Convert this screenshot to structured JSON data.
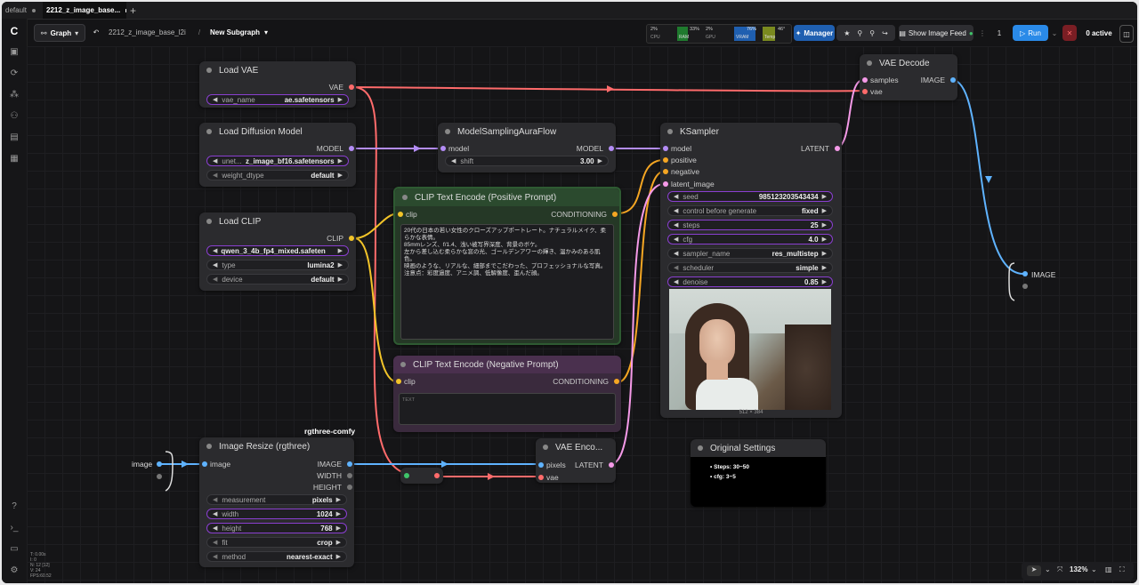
{
  "tabs": [
    {
      "label": "default"
    },
    {
      "label": "2212_z_image_base..."
    }
  ],
  "new_tab_icon": "plus-icon",
  "toolbar": {
    "graph_label": "Graph",
    "breadcrumb": "2212_z_image_base_l2i",
    "separator": "/",
    "subgraph": "New Subgraph",
    "monitor": {
      "cpu_pct": "2%",
      "cpu_label": "CPU",
      "ram_pct": "33%",
      "ram_label": "RAM",
      "gpu_pct": "2%",
      "gpu_label": "GPU",
      "vram_pct": "76%",
      "vram_label": "VRAM",
      "temp": "46°",
      "temp_label": "Temp"
    },
    "manager": "Manager",
    "show_feed": "Show Image Feed",
    "queue_count": "1",
    "run": "Run",
    "active": "0 active"
  },
  "nodes": {
    "load_vae": {
      "title": "Load VAE",
      "out": "VAE",
      "w_label": "vae_name",
      "w_value": "ae.safetensors"
    },
    "load_diff": {
      "title": "Load Diffusion Model",
      "out": "MODEL",
      "w1_label": "unet...",
      "w1_value": "z_image_bf16.safetensors",
      "w2_label": "weight_dtype",
      "w2_value": "default"
    },
    "load_clip": {
      "title": "Load CLIP",
      "out": "CLIP",
      "w1_value": "qwen_3_4b_fp4_mixed.safeten",
      "w2_label": "type",
      "w2_value": "lumina2",
      "w3_label": "device",
      "w3_value": "default"
    },
    "aura": {
      "title": "ModelSamplingAuraFlow",
      "in": "model",
      "out": "MODEL",
      "w_label": "shift",
      "w_value": "3.00"
    },
    "pos": {
      "title": "CLIP Text Encode (Positive Prompt)",
      "in": "clip",
      "out": "CONDITIONING",
      "text": "20代の日本の若い女性のクローズアップポートレート。ナチュラルメイク、柔らかな表情。\n85mmレンズ、f/1.4、浅い被写界深度、背景のボケ。\n左から差し込む柔らかな窓の光、ゴールデンアワーの輝き、温かみのある肌色。\n映画のような、リアルな、細部までこだわった、プロフェッショナルな写真。\n注意点：彩度過度、アニメ調、低解像度、歪んだ顔。"
    },
    "neg": {
      "title": "CLIP Text Encode (Negative Prompt)",
      "in": "clip",
      "out": "CONDITIONING",
      "placeholder": "TEXT"
    },
    "ksampler": {
      "title": "KSampler",
      "in1": "model",
      "in2": "positive",
      "in3": "negative",
      "in4": "latent_image",
      "out": "LATENT",
      "seed": "985123203543434",
      "cbg_label": "control before generate",
      "cbg": "fixed",
      "steps": "25",
      "cfg": "4.0",
      "sampler": "res_multistep",
      "scheduler": "simple",
      "denoise": "0.85",
      "seed_label": "seed",
      "steps_label": "steps",
      "cfg_label": "cfg",
      "sampler_label": "sampler_name",
      "scheduler_label": "scheduler",
      "denoise_label": "denoise",
      "size": "512 × 384"
    },
    "vae_decode": {
      "title": "VAE Decode",
      "in1": "samples",
      "in2": "vae",
      "out": "IMAGE"
    },
    "vae_encode": {
      "title": "VAE Enco...",
      "in1": "pixels",
      "in2": "vae",
      "out": "LATENT"
    },
    "resize": {
      "group": "rgthree-comfy",
      "title": "Image Resize (rgthree)",
      "in": "image",
      "out1": "IMAGE",
      "out2": "WIDTH",
      "out3": "HEIGHT",
      "m_label": "measurement",
      "m_value": "pixels",
      "w_label": "width",
      "w_value": "1024",
      "h_label": "height",
      "h_value": "768",
      "f_label": "fit",
      "f_value": "crop",
      "me_label": "method",
      "me_value": "nearest-exact"
    },
    "notes": {
      "title": "Original Settings",
      "line1": "Steps: 30~50",
      "line2": "cfg: 3~5"
    },
    "image_in": {
      "label": "image"
    },
    "image_out": {
      "label": "IMAGE"
    }
  },
  "stats": {
    "l1": "T: 0.00s",
    "l2": "I: 0",
    "l3": "N: 12 [12]",
    "l4": "V: 24",
    "l5": "FPS:60.52"
  },
  "bottom": {
    "zoom": "132%"
  }
}
